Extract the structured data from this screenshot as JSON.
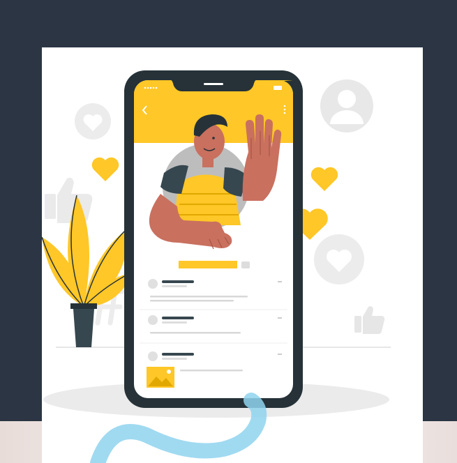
{
  "illustration": {
    "subject": "smartphone-profile-illustration",
    "colors": {
      "background": "#2b3544",
      "panel": "#ffffff",
      "accent_yellow": "#ffc727",
      "phone_body": "#263238",
      "skin": "#c9705f",
      "shirt_dark": "#37474f",
      "light_gray": "#e6e6e6",
      "swirl": "#8fd3ef"
    },
    "icons": [
      "heart-icon",
      "thumbs-up-icon",
      "user-icon",
      "image-icon",
      "plant-icon",
      "hash-icon"
    ]
  }
}
